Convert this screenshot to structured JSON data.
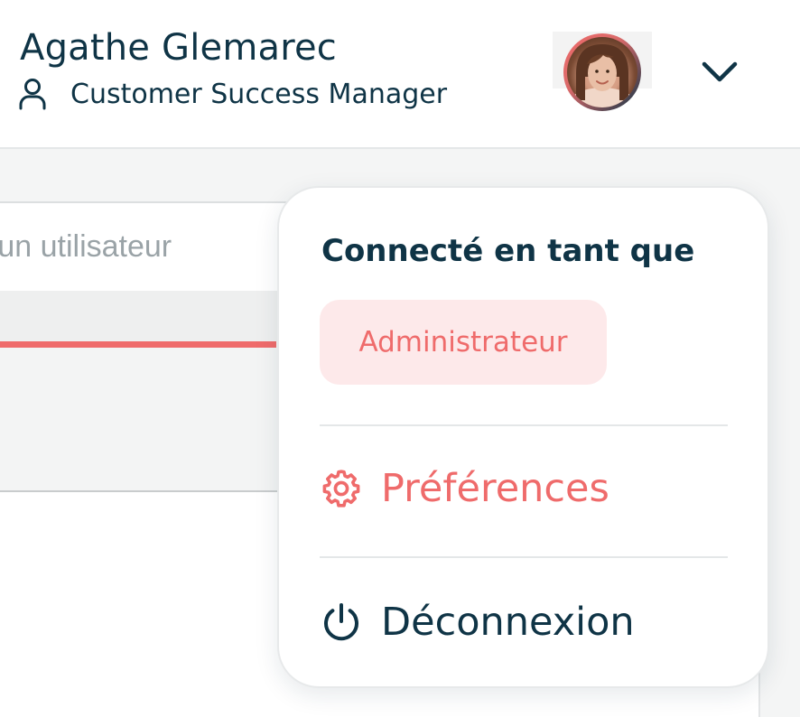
{
  "header": {
    "user_name": "Agathe Glemarec",
    "user_role": "Customer Success Manager",
    "role_icon": "user-icon",
    "avatar": "avatar",
    "menu_toggle_icon": "chevron-down-icon"
  },
  "search": {
    "placeholder": "ez un utilisateur"
  },
  "menu": {
    "heading": "Connecté en tant que",
    "role_badge": "Administrateur",
    "items": [
      {
        "label": "Préférences",
        "icon": "gear-icon"
      },
      {
        "label": "Déconnexion",
        "icon": "power-icon"
      }
    ]
  },
  "colors": {
    "primary_text": "#0f3446",
    "accent": "#ef6b6b",
    "badge_background": "#fde9ea"
  }
}
